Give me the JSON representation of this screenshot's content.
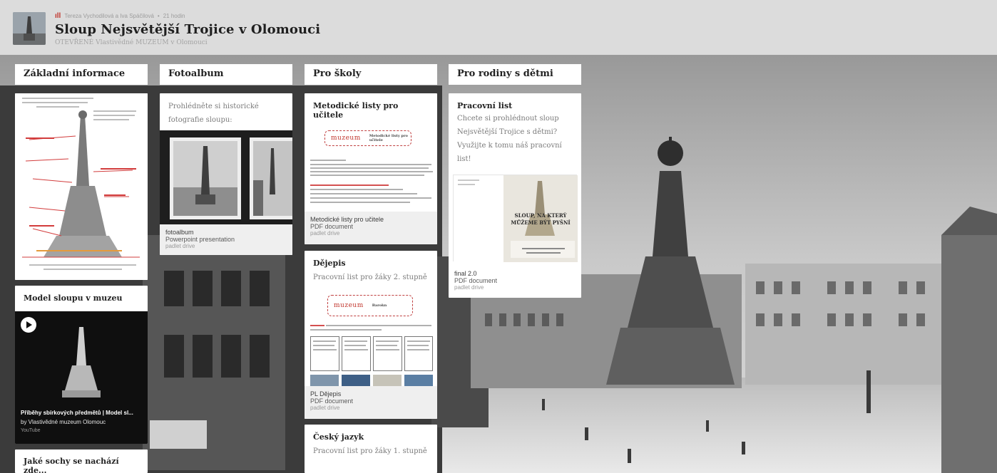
{
  "header": {
    "meta_authors": "Tereza Vychodilová a Iva Spáčilová",
    "meta_sep": "•",
    "meta_time": "21 hodin",
    "title": "Sloup Nejsvětější Trojice v Olomouci",
    "subtitle": "OTEVŘENÉ Vlastivědné MUZEUM v Olomouci"
  },
  "columns": [
    {
      "label": "Základní informace",
      "cards": [
        {
          "title": "Model sloupu v muzeu",
          "video_title": "Příběhy sbírkových předmětů | Model sl...",
          "video_author": "by Vlastivědné muzeum Olomouc",
          "video_source": "YouTube"
        },
        {
          "title": "Jaké sochy se nachází zde..."
        }
      ]
    },
    {
      "label": "Fotoalbum",
      "cards": [
        {
          "text": "Prohlédněte si historické fotografie sloupu:",
          "att_name": "fotoalbum",
          "att_type": "Powerpoint presentation",
          "att_src": "padlet drive"
        }
      ]
    },
    {
      "label": "Pro školy",
      "cards": [
        {
          "title": "Metodické listy pro učitele",
          "doc_word": "muzeum",
          "doc_sub": "Metodické listy pro učitele",
          "att_name": "Metodické listy pro učitele",
          "att_type": "PDF document",
          "att_src": "padlet drive"
        },
        {
          "title": "Dějepis",
          "text": "Pracovní list pro žáky 2. stupně",
          "doc_word": "muzeum",
          "doc_sub": "Barokn",
          "att_name": "PL Dějepis",
          "att_type": "PDF document",
          "att_src": "padlet drive"
        },
        {
          "title": "Český jazyk",
          "text": "Pracovní list pro žáky 1. stupně"
        }
      ]
    },
    {
      "label": "Pro rodiny s dětmi",
      "cards": [
        {
          "title": "Pracovní list",
          "text": "Chcete si prohlédnout sloup Nejsvětější Trojice s dětmi? Využijte k tomu náš pracovní list!",
          "doc_headline": "SLOUP, NA KTERÝ MŮŽEME BÝT PYŠNÍ",
          "att_name": "final 2.0",
          "att_type": "PDF document",
          "att_src": "padlet drive"
        }
      ]
    }
  ],
  "colors": {
    "header_bg": "#dcdcdc",
    "card_bg": "#ffffff",
    "accent_red": "#c0342b"
  }
}
